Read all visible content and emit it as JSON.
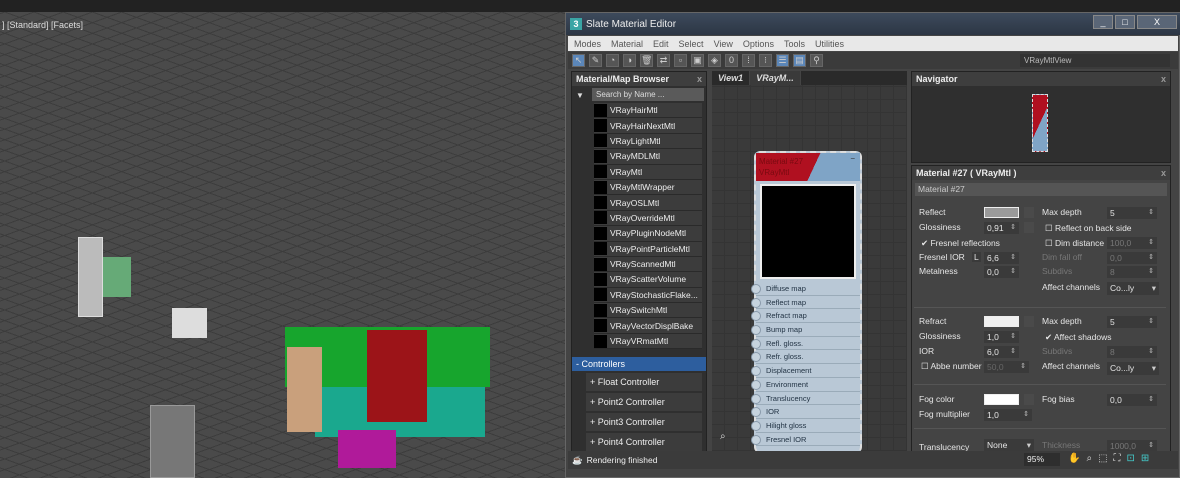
{
  "viewport": {
    "label": "] [Standard] [Facets]"
  },
  "window": {
    "title": "Slate Material Editor",
    "logo": "3",
    "min": "_",
    "max": "□",
    "close": "X"
  },
  "menu": [
    "Modes",
    "Material",
    "Edit",
    "Select",
    "View",
    "Options",
    "Tools",
    "Utilities"
  ],
  "toolbar": {
    "view_select": "VRayMtlView"
  },
  "browser": {
    "title": "Material/Map Browser",
    "close": "x",
    "search_placeholder": "Search by Name ...",
    "items": [
      "VRayHairMtl",
      "VRayHairNextMtl",
      "VRayLightMtl",
      "VRayMDLMtl",
      "VRayMtl",
      "VRayMtlWrapper",
      "VRayOSLMtl",
      "VRayOverrideMtl",
      "VRayPluginNodeMtl",
      "VRayPointParticleMtl",
      "VRayScannedMtl",
      "VRayScatterVolume",
      "VRayStochasticFlake...",
      "VRaySwitchMtl",
      "VRayVectorDisplBake",
      "VRayVRmatMtl"
    ],
    "controllers_header": "- Controllers",
    "controllers": [
      "+ Float Controller",
      "+ Point2 Controller",
      "+ Point3 Controller",
      "+ Point4 Controller"
    ]
  },
  "views": {
    "tabs": [
      "View1",
      "VRayM..."
    ],
    "node": {
      "title1": "Material #27",
      "title2": "VRayMtl",
      "minimize": "−",
      "slots": [
        "Diffuse map",
        "Reflect map",
        "Refract map",
        "Bump map",
        "Refl. gloss.",
        "Refr. gloss.",
        "Displacement",
        "Environment",
        "Translucency",
        "IOR",
        "Hilight gloss",
        "Fresnel IOR"
      ]
    }
  },
  "navigator": {
    "title": "Navigator",
    "close": "x"
  },
  "material": {
    "title": "Material #27  ( VRayMtl )",
    "close": "x",
    "name": "Material #27",
    "reflect": {
      "label": "Reflect",
      "color": "#9a9a9a",
      "glossiness_label": "Glossiness",
      "glossiness": "0,91",
      "fresnel_label": "Fresnel reflections",
      "fresnel_checked": true,
      "fresnel_ior_label": "Fresnel IOR",
      "lock": "L",
      "fresnel_ior": "6,6",
      "metalness_label": "Metalness",
      "metalness": "0,0",
      "max_depth_label": "Max depth",
      "max_depth": "5",
      "back_side_label": "Reflect on back side",
      "dim_distance_label": "Dim distance",
      "dim_distance": "100,0",
      "dim_falloff_label": "Dim fall off",
      "dim_falloff": "0,0",
      "subdivs_label": "Subdivs",
      "subdivs": "8",
      "affect_label": "Affect channels",
      "affect": "Co...ly"
    },
    "refract": {
      "label": "Refract",
      "color": "#f0f0f0",
      "glossiness_label": "Glossiness",
      "glossiness": "1,0",
      "ior_label": "IOR",
      "ior": "6,0",
      "abbe_label": "Abbe number",
      "abbe": "50,0",
      "max_depth_label": "Max depth",
      "max_depth": "5",
      "shadows_label": "Affect shadows",
      "shadows_checked": true,
      "subdivs_label": "Subdivs",
      "subdivs": "8",
      "affect_label": "Affect channels",
      "affect": "Co...ly"
    },
    "fog": {
      "color_label": "Fog color",
      "color": "#ffffff",
      "multiplier_label": "Fog multiplier",
      "multiplier": "1,0",
      "bias_label": "Fog bias",
      "bias": "0,0"
    },
    "translucency": {
      "label": "Translucency",
      "value": "None",
      "thickness_label": "Thickness",
      "thickness": "1000,0"
    }
  },
  "status": {
    "text": "Rendering finished",
    "zoom": "95%"
  }
}
